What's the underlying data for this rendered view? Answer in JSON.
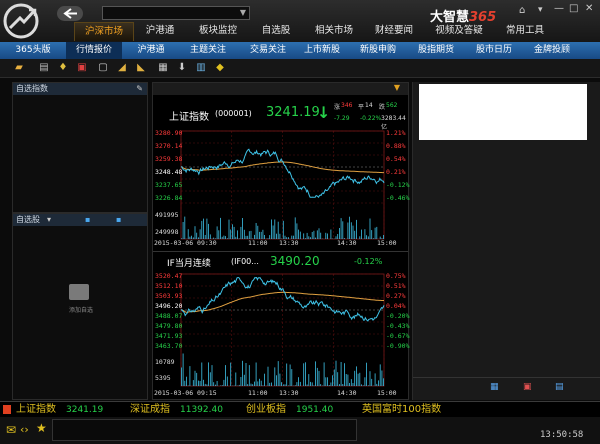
{
  "window": {
    "brand": "大智慧",
    "brand_num": "365",
    "minimize": "—",
    "maximize": "□",
    "close": "✕"
  },
  "nav": {
    "search_placeholder": "",
    "tabs": [
      "沪深市场",
      "沪港通",
      "板块监控",
      "自选股",
      "相关市场",
      "财经要闻",
      "视频及答疑",
      "常用工具"
    ],
    "active": 0
  },
  "subnav": {
    "tabs": [
      "365头版",
      "行情报价",
      "沪港通",
      "主题关注",
      "交易关注",
      "上市新股",
      "新股申购",
      "股指期货",
      "股市日历",
      "金牌投顾"
    ],
    "active": 1
  },
  "left": {
    "watch_title": "自选指数",
    "stock_title": "自选股",
    "empty_text": "添加自选"
  },
  "chart1": {
    "name": "上证指数",
    "code": "(000001)",
    "price": "3241.19",
    "arrow": "↓",
    "up_label": "涨",
    "up_count": "346",
    "flat_label": "平",
    "flat_count": "14",
    "down_label": "跌",
    "down_count": "562",
    "change": "-7.29",
    "pct": "-0.22%",
    "amount": "3283.44亿",
    "date": "2015-03-06 09:30",
    "times": [
      "11:00",
      "13:30",
      "14:30",
      "15:00"
    ],
    "y_labels": [
      "3280.90",
      "3270.14",
      "3259.38",
      "3248.48",
      "3237.65",
      "3226.84"
    ],
    "pct_labels": [
      "1.21%",
      "0.88%",
      "0.54%",
      "0.21%",
      "-0.12%",
      "-0.46%"
    ],
    "vol_labels": [
      "491995",
      "249998"
    ]
  },
  "chart2": {
    "name": "IF当月连续",
    "code": "(IF00...",
    "price": "3490.20",
    "pct": "-0.12%",
    "date": "2015-03-06 09:15",
    "times": [
      "11:00",
      "13:30",
      "14:30",
      "15:00"
    ],
    "y_labels": [
      "3520.47",
      "3512.10",
      "3503.93",
      "3496.20",
      "3488.07",
      "3479.80",
      "3471.93",
      "3463.70"
    ],
    "pct_labels": [
      "0.75%",
      "0.51%",
      "0.27%",
      "0.04%",
      "-0.20%",
      "-0.43%",
      "-0.67%",
      "-0.90%"
    ],
    "vol_labels": [
      "10789",
      "5395"
    ]
  },
  "ticker": [
    {
      "name": "上证指数",
      "value": "3241.19"
    },
    {
      "name": "深证成指",
      "value": "11392.40"
    },
    {
      "name": "创业板指",
      "value": "1951.40"
    },
    {
      "name": "英国富时100指数",
      "value": ""
    }
  ],
  "clock": "13:50:58",
  "colors": {
    "up": "#ff3b3b",
    "down": "#26d24a",
    "price_line": "#3fc3e8",
    "avg_line": "#e0a040",
    "accent": "#f0a020"
  }
}
